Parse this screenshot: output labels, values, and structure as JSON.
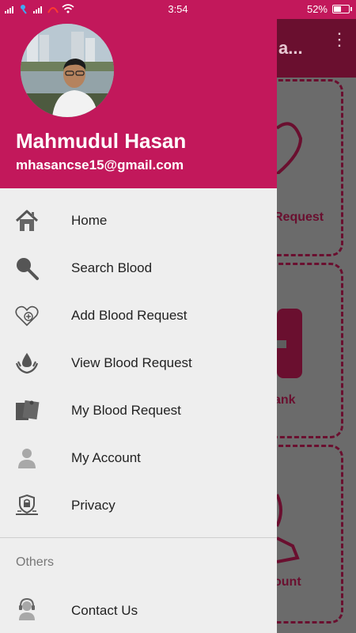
{
  "status_bar": {
    "time": "3:54",
    "battery_text": "52%",
    "battery_level": 0.52
  },
  "background_app": {
    "title_fragment": "a...",
    "card_labels": [
      "Request",
      "ank",
      "ount"
    ]
  },
  "drawer": {
    "user": {
      "name": "Mahmudul Hasan",
      "email": "mhasancse15@gmail.com"
    },
    "items": [
      {
        "label": "Home",
        "icon": "home-icon"
      },
      {
        "label": "Search Blood",
        "icon": "search-icon"
      },
      {
        "label": "Add Blood Request",
        "icon": "heart-plus-icon"
      },
      {
        "label": "View Blood Request",
        "icon": "blood-drop-hands-icon"
      },
      {
        "label": "My Blood Request",
        "icon": "notes-icon"
      },
      {
        "label": "My Account",
        "icon": "person-icon"
      },
      {
        "label": "Privacy",
        "icon": "shield-icon"
      }
    ],
    "section_title": "Others",
    "other_items": [
      {
        "label": "Contact Us",
        "icon": "support-agent-icon"
      }
    ]
  },
  "colors": {
    "primary": "#c2185b",
    "drawer_bg": "#eeeeee",
    "scrim_primary": "#6a0f2f"
  }
}
